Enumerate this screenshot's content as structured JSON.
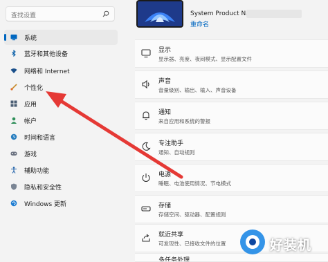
{
  "search": {
    "placeholder": "查找设置"
  },
  "sidebar": {
    "items": [
      {
        "label": "系统",
        "icon": "monitor-icon",
        "active": true
      },
      {
        "label": "蓝牙和其他设备",
        "icon": "bluetooth-icon"
      },
      {
        "label": "网络和 Internet",
        "icon": "wifi-icon"
      },
      {
        "label": "个性化",
        "icon": "paintbrush-icon"
      },
      {
        "label": "应用",
        "icon": "apps-icon"
      },
      {
        "label": "帐户",
        "icon": "person-icon"
      },
      {
        "label": "时间和语言",
        "icon": "globe-clock-icon"
      },
      {
        "label": "游戏",
        "icon": "gamepad-icon"
      },
      {
        "label": "辅助功能",
        "icon": "accessibility-icon"
      },
      {
        "label": "隐私和安全性",
        "icon": "shield-icon"
      },
      {
        "label": "Windows 更新",
        "icon": "update-icon"
      }
    ]
  },
  "header": {
    "device_name": "System Product Name",
    "rename": "重命名"
  },
  "cards": [
    {
      "title": "显示",
      "desc": "显示器、亮度、夜间模式、显示配置文件",
      "icon": "display-icon"
    },
    {
      "title": "声音",
      "desc": "音量级别、输出、输入、声音设备",
      "icon": "speaker-icon"
    },
    {
      "title": "通知",
      "desc": "来自应用和系统的警报",
      "icon": "bell-icon"
    },
    {
      "title": "专注助手",
      "desc": "通知、自动规则",
      "icon": "moon-icon"
    },
    {
      "title": "电源",
      "desc": "睡眠、电池使用情况、节电模式",
      "icon": "power-icon"
    },
    {
      "title": "存储",
      "desc": "存储空间、驱动器、配置规则",
      "icon": "storage-icon"
    },
    {
      "title": "就近共享",
      "desc": "可发现性、已接收文件的位置",
      "icon": "share-icon"
    },
    {
      "title": "多任务处理",
      "desc": "",
      "icon": "multitask-icon"
    }
  ],
  "watermark": {
    "text": "好装机"
  },
  "colors": {
    "accent": "#0067c0",
    "arrow": "#e53935"
  }
}
